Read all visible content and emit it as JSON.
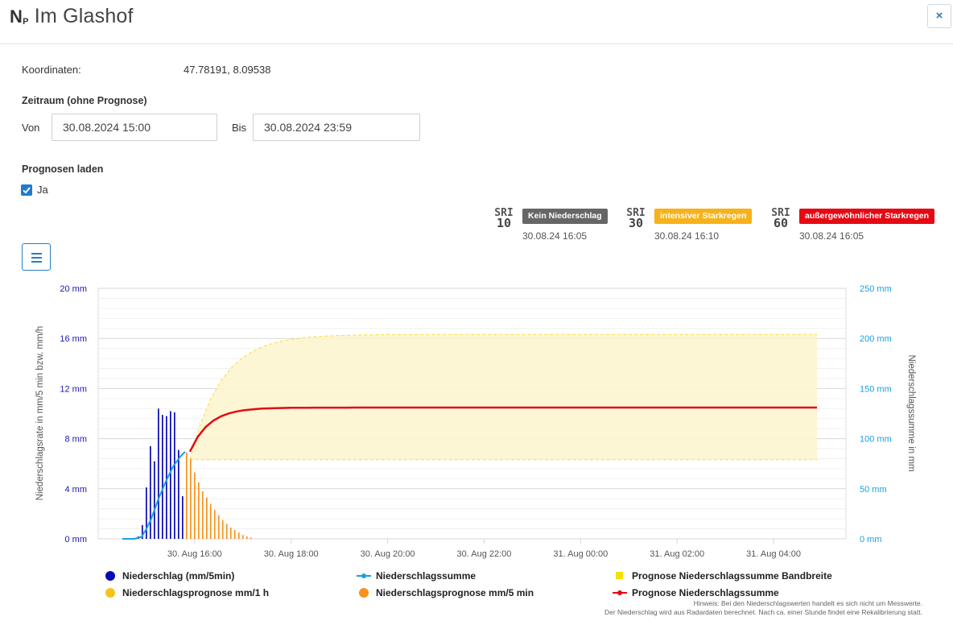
{
  "header": {
    "title_prefix": "N",
    "title_sub": "P",
    "title": "Im Glashof",
    "close_label": "×"
  },
  "coords": {
    "label": "Koordinaten:",
    "value": "47.78191, 8.09538"
  },
  "period": {
    "label": "Zeitraum (ohne Prognose)",
    "from_label": "Von",
    "from_value": "30.08.2024 15:00",
    "to_label": "Bis",
    "to_value": "30.08.2024 23:59"
  },
  "forecast": {
    "label": "Prognosen laden",
    "checkbox_label": "Ja",
    "checked": true
  },
  "sri": [
    {
      "label": "SRI",
      "num": "10",
      "badge": "Kein Niederschlag",
      "color": "#666666",
      "time": "30.08.24 16:05"
    },
    {
      "label": "SRI",
      "num": "30",
      "badge": "intensiver Starkregen",
      "color": "#f7b21b",
      "time": "30.08.24 16:10"
    },
    {
      "label": "SRI",
      "num": "60",
      "badge": "außergewöhnlicher Starkregen",
      "color": "#e50914",
      "time": "30.08.24 16:05"
    }
  ],
  "chart_data": {
    "type": "bar",
    "y_left": {
      "label": "Niederschlagsrate in mm/5 min bzw. mm/h",
      "range": [
        0,
        20
      ],
      "ticks": [
        "0 mm",
        "4 mm",
        "8 mm",
        "12 mm",
        "16 mm",
        "20 mm"
      ],
      "color": "#1a1ab0"
    },
    "y_right": {
      "label": "Niederschlagssumme in mm",
      "range": [
        0,
        250
      ],
      "ticks": [
        "0 mm",
        "50 mm",
        "100 mm",
        "150 mm",
        "200 mm",
        "250 mm"
      ],
      "color": "#1aa0e0"
    },
    "x_range_hours": [
      14.0,
      29.5
    ],
    "x_ticks": [
      {
        "h": 16,
        "label": "30. Aug 16:00"
      },
      {
        "h": 18,
        "label": "30. Aug 18:00"
      },
      {
        "h": 20,
        "label": "30. Aug 20:00"
      },
      {
        "h": 22,
        "label": "30. Aug 22:00"
      },
      {
        "h": 24,
        "label": "31. Aug 00:00"
      },
      {
        "h": 26,
        "label": "31. Aug 02:00"
      },
      {
        "h": 28,
        "label": "31. Aug 04:00"
      }
    ],
    "niederschlag_5min": {
      "start_h": 14.833,
      "step_h": 0.0833,
      "values": [
        0.2,
        1.1,
        4.1,
        7.4,
        6.2,
        10.4,
        9.9,
        9.8,
        10.2,
        10.1,
        7.1,
        3.4
      ]
    },
    "prognose_5min": {
      "start_h": 15.833,
      "step_h": 0.0833,
      "values": [
        6.9,
        6.4,
        5.3,
        4.5,
        3.8,
        3.3,
        2.8,
        2.3,
        1.9,
        1.5,
        1.2,
        0.9,
        0.7,
        0.5,
        0.3,
        0.2,
        0.1
      ]
    },
    "summe": {
      "x": [
        14.5,
        14.75,
        14.9,
        15.0,
        15.1,
        15.25,
        15.4,
        15.55,
        15.7,
        15.8
      ],
      "y": [
        0,
        0,
        2,
        10,
        20,
        40,
        57,
        72,
        82,
        87
      ]
    },
    "prognose_summe": {
      "start_h": 15.9,
      "end_h": 28.9,
      "start_y": 87,
      "end_y": 131
    },
    "bandbreite": {
      "lower": 79,
      "upper_end": 204,
      "start_h": 15.9,
      "end_h": 28.9
    },
    "legend": [
      {
        "label": "Niederschlag (mm/5min)",
        "color": "#0a0ab4",
        "marker": "circle"
      },
      {
        "label": "Niederschlagssumme",
        "color": "#1aa0e0",
        "marker": "line"
      },
      {
        "label": "Prognose Niederschlagssumme Bandbreite",
        "color": "#f5e200",
        "marker": "square"
      },
      {
        "label": "Niederschlagsprognose mm/1 h",
        "color": "#f7c31a",
        "marker": "circle"
      },
      {
        "label": "Niederschlagsprognose mm/5 min",
        "color": "#f7931e",
        "marker": "circle"
      },
      {
        "label": "Prognose Niederschlagssumme",
        "color": "#e50914",
        "marker": "line"
      }
    ]
  },
  "hint": {
    "line1": "Hinweis: Bei den Niederschlagswerten handelt es sich nicht um Messwerte.",
    "line2": "Der Niederschlag wird aus Radardaten berechnet. Nach ca. einer Stunde findet eine Rekalibrierung statt."
  }
}
